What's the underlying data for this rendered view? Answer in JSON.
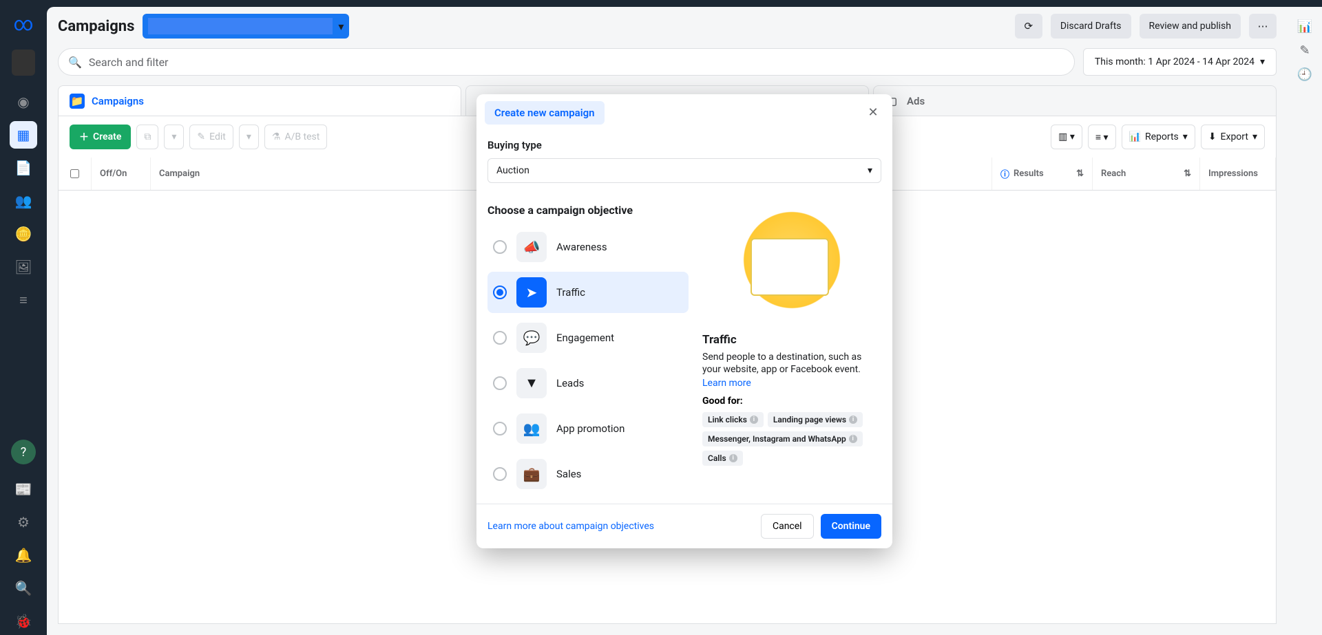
{
  "header": {
    "title": "Campaigns",
    "discard": "Discard Drafts",
    "review": "Review and publish"
  },
  "search": {
    "placeholder": "Search and filter"
  },
  "dateRange": "This month: 1 Apr 2024 - 14 Apr 2024",
  "tabs": {
    "campaigns": "Campaigns",
    "ads": "Ads"
  },
  "toolbar": {
    "create": "Create",
    "edit": "Edit",
    "abtest": "A/B test",
    "reports": "Reports",
    "export": "Export"
  },
  "columns": {
    "offon": "Off/On",
    "campaign": "Campaign",
    "results": "Results",
    "reach": "Reach",
    "impressions": "Impressions"
  },
  "modal": {
    "tab": "Create new campaign",
    "buyingTypeLabel": "Buying type",
    "buyingTypeValue": "Auction",
    "chooseLabel": "Choose a campaign objective",
    "objectives": {
      "awareness": "Awareness",
      "traffic": "Traffic",
      "engagement": "Engagement",
      "leads": "Leads",
      "appPromotion": "App promotion",
      "sales": "Sales"
    },
    "detail": {
      "title": "Traffic",
      "desc": "Send people to a destination, such as your website, app or Facebook event.",
      "learnMore": "Learn more",
      "goodFor": "Good for:",
      "chips": {
        "linkClicks": "Link clicks",
        "landingPageViews": "Landing page views",
        "messenger": "Messenger, Instagram and WhatsApp",
        "calls": "Calls"
      }
    },
    "footer": {
      "learn": "Learn more about campaign objectives",
      "cancel": "Cancel",
      "continue": "Continue"
    }
  }
}
